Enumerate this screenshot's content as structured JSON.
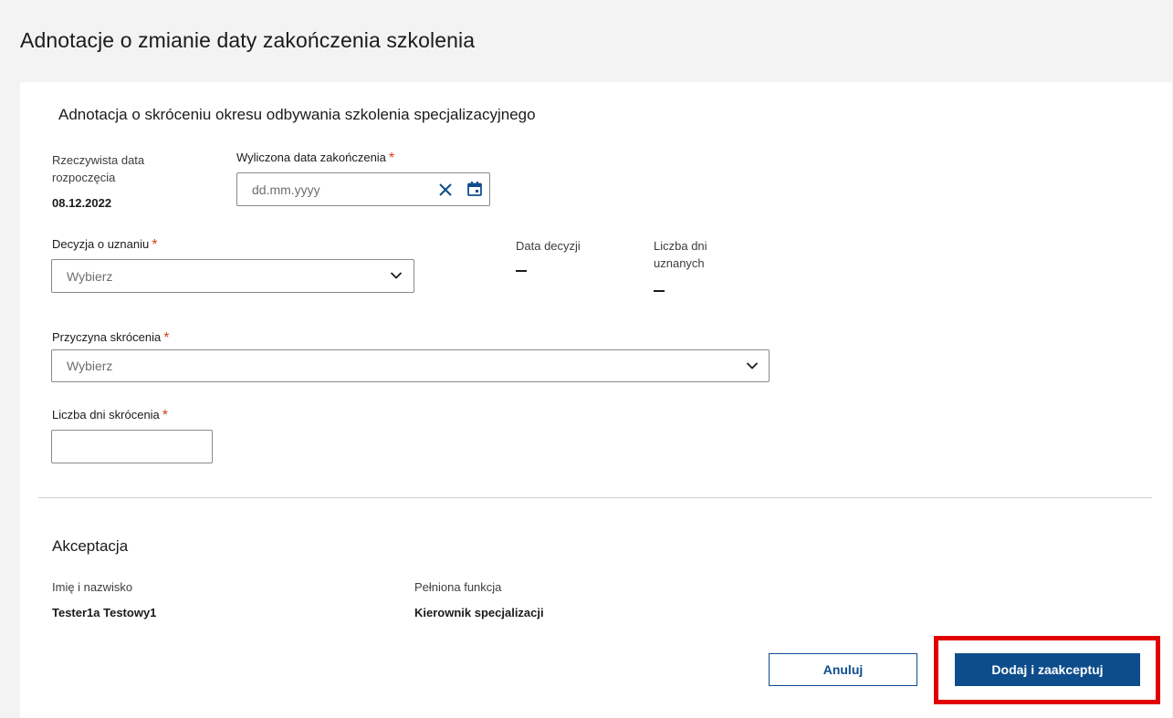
{
  "page": {
    "title": "Adnotacje o zmianie daty zakończenia szkolenia"
  },
  "form": {
    "section_title": "Adnotacja o skróceniu okresu odbywania szkolenia specjalizacyjnego",
    "start_date_label": "Rzeczywista data rozpoczęcia",
    "start_date_label_line1": "Rzeczywista data",
    "start_date_label_line2": "rozpoczęcia",
    "start_date_value": "08.12.2022",
    "end_date_label": "Wyliczona data zakończenia",
    "end_date_required": "*",
    "end_date_placeholder": "dd.mm.yyyy",
    "decision_label": "Decyzja o uznaniu",
    "decision_required": "*",
    "decision_selected": "Wybierz",
    "decision_date_label": "Data decyzji",
    "recognized_days_label_line1": "Liczba dni",
    "recognized_days_label_line2": "uznanych",
    "reason_label": "Przyczyna skrócenia",
    "reason_required": "*",
    "reason_selected": "Wybierz",
    "shortening_days_label": "Liczba dni skrócenia",
    "shortening_days_required": "*",
    "shortening_days_value": ""
  },
  "acceptance": {
    "section_title": "Akceptacja",
    "name_label": "Imię i nazwisko",
    "name_value": "Tester1a Testowy1",
    "role_label": "Pełniona funkcja",
    "role_value": "Kierownik specjalizacji"
  },
  "actions": {
    "cancel_label": "Anuluj",
    "submit_label": "Dodaj i zaakceptuj"
  },
  "colors": {
    "primary": "#0e4d8c",
    "required": "#d4421c",
    "highlight": "#e10000"
  }
}
